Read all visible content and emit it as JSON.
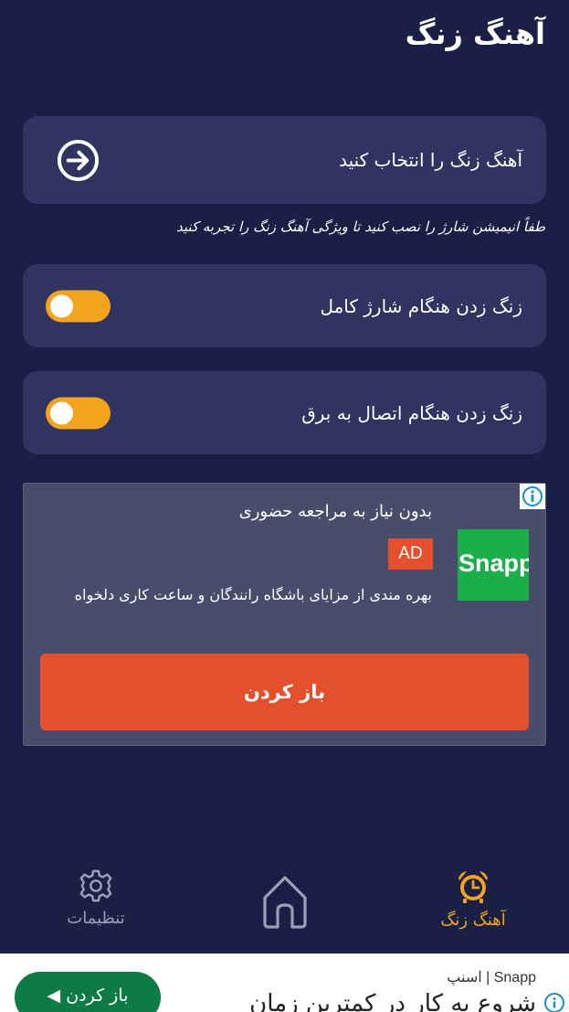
{
  "header": {
    "title": "آهنگ زنگ"
  },
  "ringtone_select": {
    "label": "آهنگ زنگ را انتخاب کنید"
  },
  "hint": "طفاً انیمیشن شارژ را نصب کنید تا ویژگی آهنگ زنگ را تجربه کنید",
  "toggles": [
    {
      "label": "زنگ زدن هنگام شارژ کامل",
      "on": false
    },
    {
      "label": "زنگ زدن هنگام اتصال به برق",
      "on": false
    }
  ],
  "ad": {
    "headline": "بدون نیاز به مراجعه حضوری",
    "badge": "AD",
    "logo_text": "Snapp",
    "body": "بهره مندی از مزایای باشگاه رانندگان و ساعت کاری دلخواه",
    "open_button": "باز کردن"
  },
  "tabs": [
    {
      "label": "تنظیمات",
      "icon": "gear-icon",
      "active": false
    },
    {
      "label": "",
      "icon": "home-icon",
      "active": false
    },
    {
      "label": "آهنگ زنگ",
      "icon": "alarm-clock-icon",
      "active": true
    }
  ],
  "banner": {
    "source": "Snapp | اسنپ",
    "headline": "شروع به کار در کمترین زمان",
    "open_button": "باز کردن"
  },
  "colors": {
    "background": "#1a1f45",
    "card": "#2f3560",
    "accent": "#f4a41c",
    "ad_button": "#e4502d",
    "snapp_green": "#1aaf4b",
    "banner_button": "#0e7a46"
  }
}
